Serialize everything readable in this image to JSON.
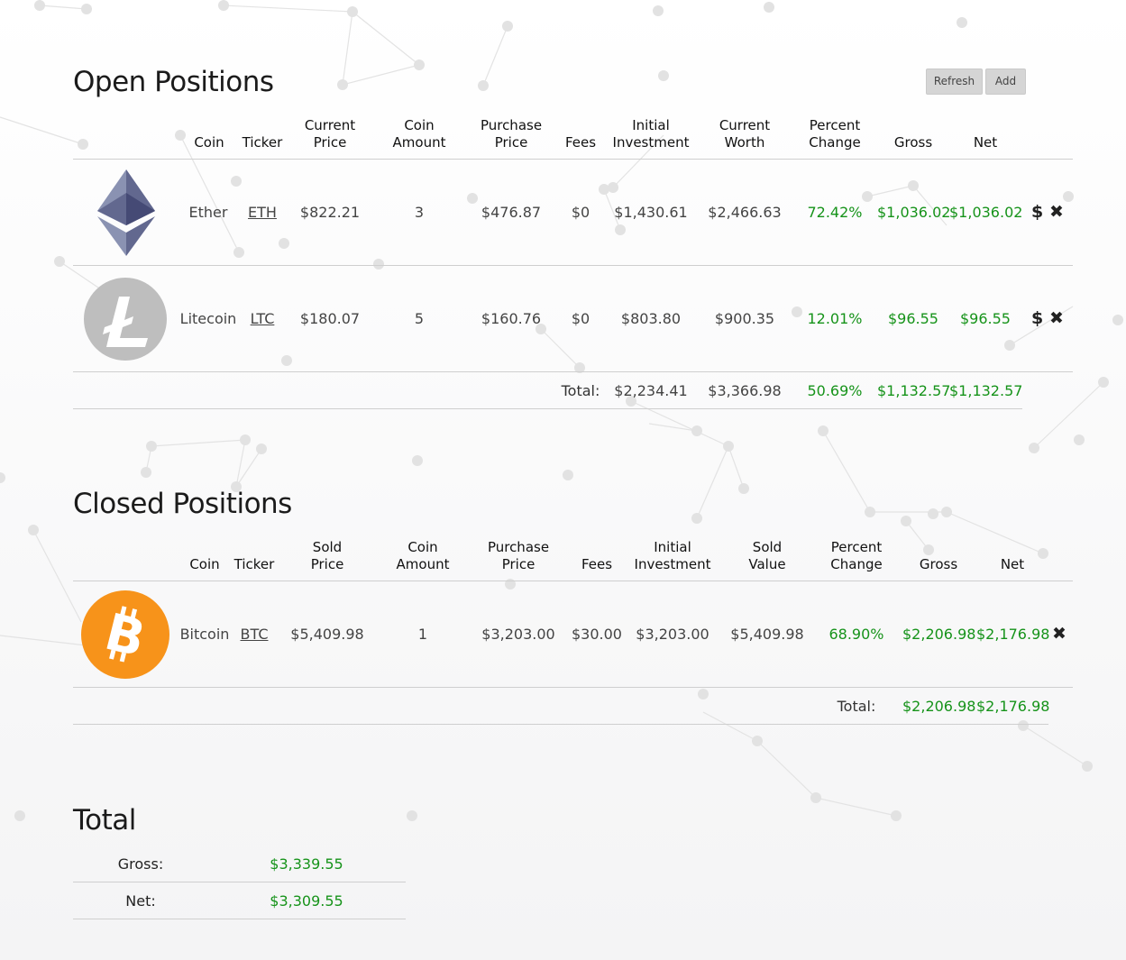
{
  "open_positions": {
    "title": "Open Positions",
    "refresh_label": "Refresh",
    "add_label": "Add",
    "headers": {
      "coin": "Coin",
      "ticker": "Ticker",
      "current_price": [
        "Current",
        "Price"
      ],
      "coin_amount": [
        "Coin",
        "Amount"
      ],
      "purchase_price": [
        "Purchase",
        "Price"
      ],
      "fees": "Fees",
      "initial_investment": [
        "Initial",
        "Investment"
      ],
      "current_worth": [
        "Current",
        "Worth"
      ],
      "percent_change": [
        "Percent",
        "Change"
      ],
      "gross": "Gross",
      "net": "Net"
    },
    "rows": [
      {
        "coin": "Ether",
        "ticker": "ETH",
        "current_price": "$822.21",
        "amount": "3",
        "purchase_price": "$476.87",
        "fees": "$0",
        "initial": "$1,430.61",
        "worth": "$2,466.63",
        "percent": "72.42%",
        "gross": "$1,036.02",
        "net": "$1,036.02",
        "sell_icon": "$",
        "delete_icon": "✖"
      },
      {
        "coin": "Litecoin",
        "ticker": "LTC",
        "current_price": "$180.07",
        "amount": "5",
        "purchase_price": "$160.76",
        "fees": "$0",
        "initial": "$803.80",
        "worth": "$900.35",
        "percent": "12.01%",
        "gross": "$96.55",
        "net": "$96.55",
        "sell_icon": "$",
        "delete_icon": "✖"
      }
    ],
    "total": {
      "label": "Total:",
      "initial": "$2,234.41",
      "worth": "$3,366.98",
      "percent": "50.69%",
      "gross": "$1,132.57",
      "net": "$1,132.57"
    }
  },
  "closed_positions": {
    "title": "Closed Positions",
    "headers": {
      "coin": "Coin",
      "ticker": "Ticker",
      "sold_price": [
        "Sold",
        "Price"
      ],
      "coin_amount": [
        "Coin",
        "Amount"
      ],
      "purchase_price": [
        "Purchase",
        "Price"
      ],
      "fees": "Fees",
      "initial_investment": [
        "Initial",
        "Investment"
      ],
      "sold_value": [
        "Sold",
        "Value"
      ],
      "percent_change": [
        "Percent",
        "Change"
      ],
      "gross": "Gross",
      "net": "Net"
    },
    "rows": [
      {
        "coin": "Bitcoin",
        "ticker": "BTC",
        "sold_price": "$5,409.98",
        "amount": "1",
        "purchase_price": "$3,203.00",
        "fees": "$30.00",
        "initial": "$3,203.00",
        "sold_value": "$5,409.98",
        "percent": "68.90%",
        "gross": "$2,206.98",
        "net": "$2,176.98",
        "delete_icon": "✖"
      }
    ],
    "total": {
      "label": "Total:",
      "gross": "$2,206.98",
      "net": "$2,176.98"
    }
  },
  "totals": {
    "title": "Total",
    "gross_label": "Gross:",
    "gross_value": "$3,339.55",
    "net_label": "Net:",
    "net_value": "$3,309.55"
  },
  "icons": {
    "ether": "ethereum-logo-icon",
    "litecoin": "litecoin-logo-icon",
    "bitcoin": "bitcoin-logo-icon"
  },
  "colors": {
    "positive": "#16931a",
    "bitcoin": "#f7931a",
    "litecoin": "#bebebe",
    "ether": "#627eea"
  }
}
